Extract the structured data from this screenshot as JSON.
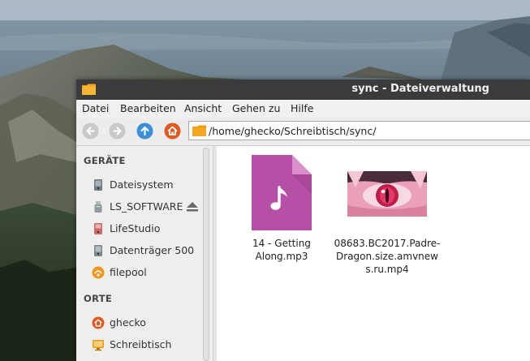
{
  "window": {
    "title": "sync - Dateiverwaltung"
  },
  "menubar": {
    "items": [
      "Datei",
      "Bearbeiten",
      "Ansicht",
      "Gehen zu",
      "Hilfe"
    ]
  },
  "toolbar": {
    "location_path": "/home/ghecko/Schreibtisch/sync/"
  },
  "sidebar": {
    "devices_title": "GERÄTE",
    "devices": [
      {
        "label": "Dateisystem",
        "icon": "hard-drive-icon"
      },
      {
        "label": "LS_SOFTWARE",
        "icon": "usb-drive-icon",
        "ejectable": true
      },
      {
        "label": "LifeStudio",
        "icon": "removable-drive-icon"
      },
      {
        "label": "Datenträger 500 ...",
        "icon": "hard-drive-icon"
      },
      {
        "label": "filepool",
        "icon": "network-share-icon"
      }
    ],
    "places_title": "ORTE",
    "places": [
      {
        "label": "ghecko",
        "icon": "home-icon"
      },
      {
        "label": "Schreibtisch",
        "icon": "desktop-icon"
      }
    ]
  },
  "files": [
    {
      "name": "14 - Getting Along.mp3",
      "type": "audio"
    },
    {
      "name": "08683.BC2017.Padre-Dragon.size.amvnews.ru.mp4",
      "type": "video"
    }
  ],
  "colors": {
    "titlebar": "#3b3b3b",
    "accent_blue": "#3a8fd6",
    "home_orange": "#e2581e",
    "folder_orange": "#f5a623",
    "audio_file_purple": "#b64fa6"
  }
}
